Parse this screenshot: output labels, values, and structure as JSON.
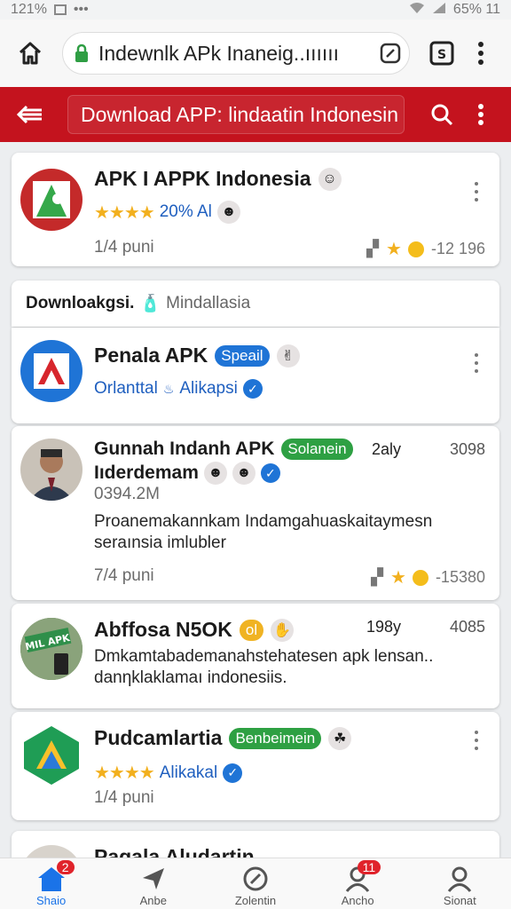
{
  "status_bar": {
    "left_text": "121%",
    "right_text": "65% 11"
  },
  "browser": {
    "url": "Indewnlk APk Inaneig..ıııııı"
  },
  "header": {
    "title": "Download APP: lindaatin Indonesin"
  },
  "cards": [
    {
      "title": "APK I  APPK Indonesia",
      "rating_text": "20% Al",
      "meta": "1/4 puni",
      "react_count": "-12 196"
    },
    {
      "section_text": "Downloakgsi.",
      "section_sub": "Mindallasia"
    },
    {
      "title": "Penala APK",
      "badge": "Speail",
      "sub": "Orlanttal",
      "sub2": "Alikapsi"
    },
    {
      "title": "Gunnah Indanh APK",
      "badge": "Solanein",
      "time": "2aly",
      "count": "3098",
      "subtitle": "Iıderdemam",
      "stat": "0394.2M",
      "body": "Proanemakannkam Indamgahuaskaitaymesn seraınsia imlubler",
      "meta": "7/4 puni",
      "react_count": "-15380"
    },
    {
      "title": "Abffosa N5OK",
      "badge": "ol",
      "time": "198y",
      "count": "4085",
      "icon_text": "MIL APK",
      "body": "Dmkamtabademanahstehatesen apk lensan.. danηklaklamaı indonesiis."
    },
    {
      "title": "Pudcamlartia",
      "badge": "Benbeimein",
      "sub": "Alikakal",
      "meta": "1/4 puni"
    },
    {
      "title": "Pagala Aludartin"
    }
  ],
  "bottom_nav": {
    "items": [
      {
        "label": "Shaio",
        "badge": "2"
      },
      {
        "label": "Anbe"
      },
      {
        "label": "Zolentin"
      },
      {
        "label": "Ancho",
        "badge": "11"
      },
      {
        "label": "Sionat"
      }
    ]
  },
  "colors": {
    "header_red": "#c4131e",
    "accent_blue": "#1f74d6",
    "badge_green": "#2ea043",
    "star_yellow": "#f2b01e"
  }
}
